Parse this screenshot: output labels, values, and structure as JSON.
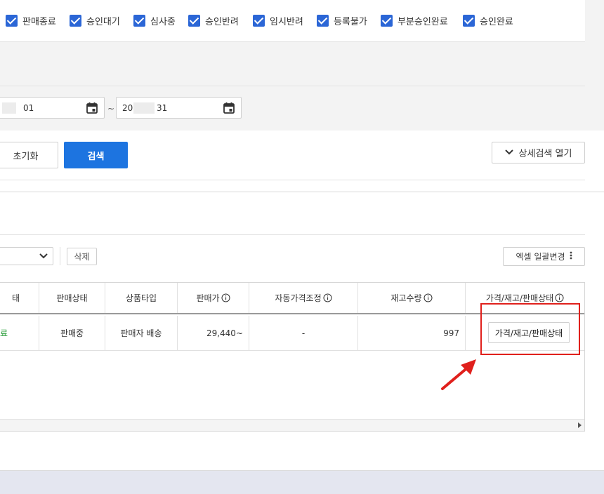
{
  "status_filters": [
    {
      "label": "판매종료",
      "checked": true
    },
    {
      "label": "승인대기",
      "checked": true
    },
    {
      "label": "심사중",
      "checked": true
    },
    {
      "label": "승인반려",
      "checked": true
    },
    {
      "label": "임시반려",
      "checked": true
    },
    {
      "label": "등록불가",
      "checked": true
    },
    {
      "label": "부분승인완료",
      "checked": true
    },
    {
      "label": "승인완료",
      "checked": true
    }
  ],
  "date_range": {
    "start": "01",
    "separator": "~",
    "end_prefix": "20",
    "end_suffix": "31"
  },
  "actions": {
    "reset": "초기화",
    "search": "검색",
    "detail_search": "상세검색 열기"
  },
  "toolbar": {
    "delete": "삭제",
    "excel_bulk_edit": "엑셀 일괄변경"
  },
  "table": {
    "columns": [
      "태",
      "판매상태",
      "상품타입",
      "판매가",
      "자동가격조정",
      "재고수량",
      "가격/재고/판매상태"
    ],
    "rows": [
      {
        "status_partial": "료",
        "sale_status": "판매중",
        "product_type": "판매자 배송",
        "price": "29,440~",
        "auto_price": "-",
        "stock": "997",
        "action_label": "가격/재고/판매상태"
      }
    ]
  },
  "colors": {
    "accent": "#1d74e0",
    "checkbox": "#2b66d6",
    "highlight": "#e0201c",
    "status_green": "#2a9d3a"
  }
}
